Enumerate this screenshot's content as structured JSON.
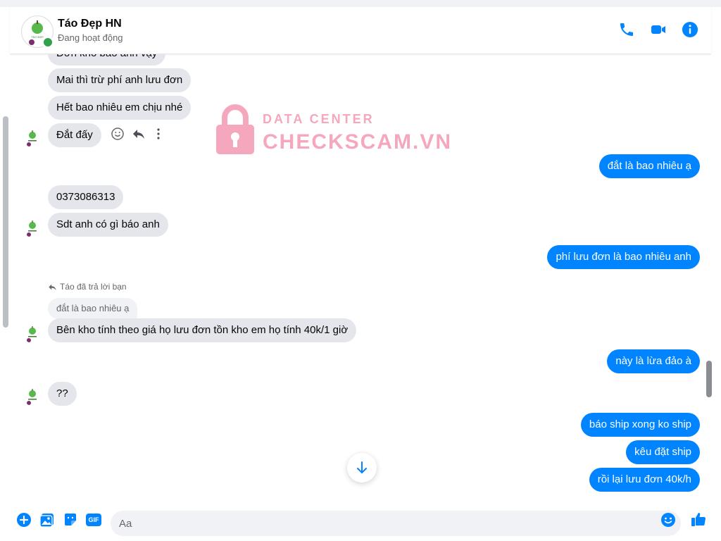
{
  "header": {
    "contact_name": "Táo Đẹp HN",
    "status": "Đang hoạt động",
    "icons": [
      "phone-icon",
      "video-call-icon",
      "info-icon"
    ]
  },
  "messages": {
    "in_0": "Đơn kho bảo anh vậy",
    "in_1": "Mai thì trừ phí anh lưu đơn",
    "in_2": "Hết bao nhiêu em chịu nhé",
    "in_3": "Đắt đấy",
    "out_0": "đắt là bao nhiêu ạ",
    "in_4": "0373086313",
    "in_5": "Sdt anh có gì báo anh",
    "out_1": "phí lưu đơn là bao nhiêu anh",
    "reply_note": "Táo đã trả lời bạn",
    "quoted": "đắt là bao nhiêu ạ",
    "in_6": "Bên kho tính theo giá họ lưu đơn tồn kho em họ tính 40k/1 giờ",
    "out_2": "này là lừa đảo à",
    "in_7": "??",
    "out_3": "báo ship xong ko ship",
    "out_4": "kêu đặt ship",
    "out_5": "rồi lại lưu đơn 40k/h"
  },
  "watermark": {
    "line1": "DATA CENTER",
    "line2": "CHECKSCAM.VN"
  },
  "composer": {
    "placeholder": "Aa",
    "gif_label": "GIF",
    "icons": [
      "add-icon",
      "image-icon",
      "sticker-icon",
      "gif-icon",
      "emoji-icon",
      "like-icon"
    ]
  },
  "colors": {
    "accent": "#0084ff",
    "incoming_bubble": "#e4e6eb",
    "online": "#31a24c",
    "watermark": "#f5a7bd"
  }
}
